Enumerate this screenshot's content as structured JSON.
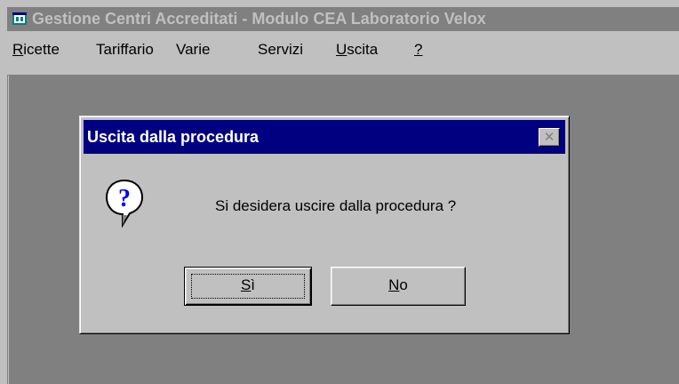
{
  "window": {
    "title": "Gestione Centri Accreditati - Modulo CEA Laboratorio Velox",
    "icon": "app-window-icon"
  },
  "menu": {
    "items": [
      {
        "label": "Ricette",
        "mnemonic": "R",
        "rest": "icette"
      },
      {
        "label": "Tariffario",
        "mnemonic": "",
        "rest": "Tariffario"
      },
      {
        "label": "Varie",
        "mnemonic": "",
        "rest": "Varie"
      },
      {
        "label": "Servizi",
        "mnemonic": "",
        "rest": "Servizi"
      },
      {
        "label": "Uscita",
        "mnemonic": "U",
        "rest": "scita"
      },
      {
        "label": "?",
        "mnemonic": "?",
        "rest": ""
      }
    ]
  },
  "dialog": {
    "title": "Uscita dalla procedura",
    "message": "Si desidera uscire dalla procedura ?",
    "icon": "question-icon",
    "close_symbol": "✕",
    "buttons": {
      "yes": {
        "label": "Sì",
        "mnemonic": "S",
        "rest": "ì"
      },
      "no": {
        "label": "No",
        "mnemonic": "N",
        "rest": "o"
      }
    }
  },
  "colors": {
    "face": "#c0c0c0",
    "workspace": "#808080",
    "dialog_titlebar": "#000080",
    "inactive_titlebar": "#808080"
  }
}
